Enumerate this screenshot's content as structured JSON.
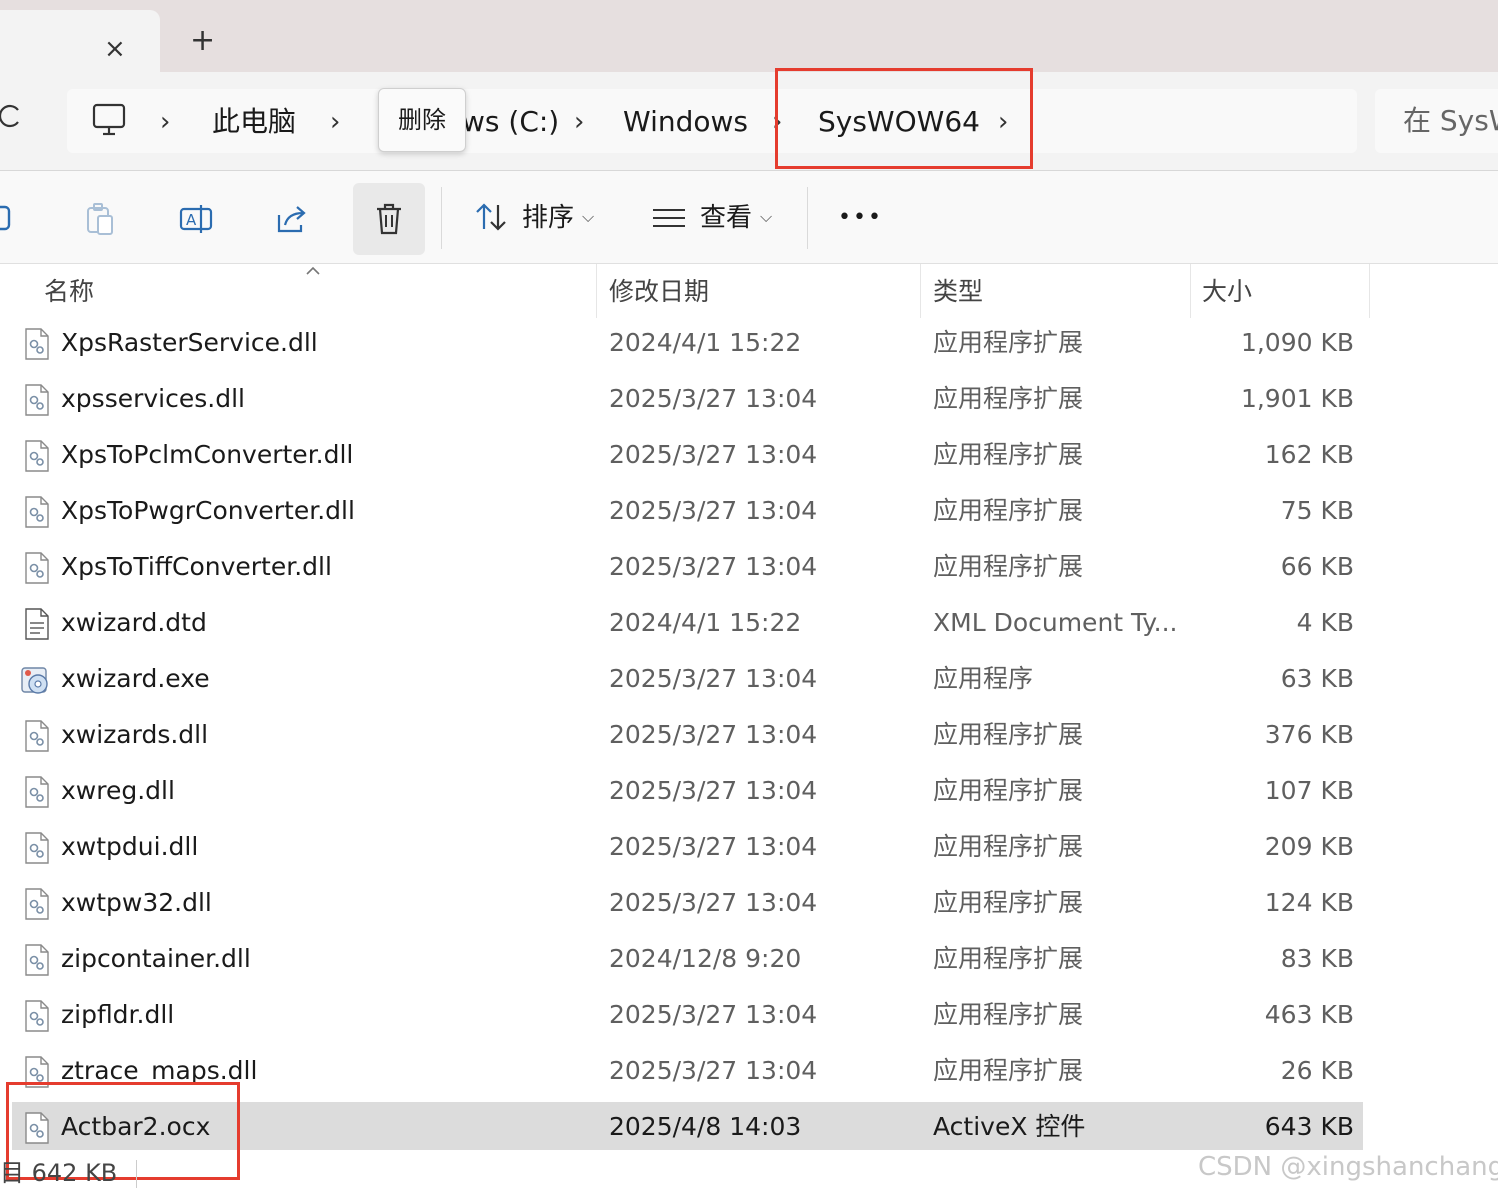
{
  "tab": {
    "close_icon": "×",
    "new_icon": "+"
  },
  "address": {
    "refresh_icon": "refresh-icon",
    "breadcrumb": [
      "此电脑",
      "ws (C:)",
      "Windows",
      "SysWOW64"
    ],
    "chevron": "›",
    "tooltip": "删除",
    "search_placeholder": "在 SysW"
  },
  "toolbar": {
    "sort_label": "排序",
    "view_label": "查看",
    "more_label": "•••",
    "caret": "⌵"
  },
  "columns": {
    "name": "名称",
    "date": "修改日期",
    "type": "类型",
    "size": "大小"
  },
  "files": [
    {
      "name": "XpsRasterService.dll",
      "date": "2024/4/1 15:22",
      "type": "应用程序扩展",
      "size": "1,090 KB",
      "icon": "dll-icon"
    },
    {
      "name": "xpsservices.dll",
      "date": "2025/3/27 13:04",
      "type": "应用程序扩展",
      "size": "1,901 KB",
      "icon": "dll-icon"
    },
    {
      "name": "XpsToPclmConverter.dll",
      "date": "2025/3/27 13:04",
      "type": "应用程序扩展",
      "size": "162 KB",
      "icon": "dll-icon"
    },
    {
      "name": "XpsToPwgrConverter.dll",
      "date": "2025/3/27 13:04",
      "type": "应用程序扩展",
      "size": "75 KB",
      "icon": "dll-icon"
    },
    {
      "name": "XpsToTiffConverter.dll",
      "date": "2025/3/27 13:04",
      "type": "应用程序扩展",
      "size": "66 KB",
      "icon": "dll-icon"
    },
    {
      "name": "xwizard.dtd",
      "date": "2024/4/1 15:22",
      "type": "XML Document Ty...",
      "size": "4 KB",
      "icon": "document-icon"
    },
    {
      "name": "xwizard.exe",
      "date": "2025/3/27 13:04",
      "type": "应用程序",
      "size": "63 KB",
      "icon": "exe-icon"
    },
    {
      "name": "xwizards.dll",
      "date": "2025/3/27 13:04",
      "type": "应用程序扩展",
      "size": "376 KB",
      "icon": "dll-icon"
    },
    {
      "name": "xwreg.dll",
      "date": "2025/3/27 13:04",
      "type": "应用程序扩展",
      "size": "107 KB",
      "icon": "dll-icon"
    },
    {
      "name": "xwtpdui.dll",
      "date": "2025/3/27 13:04",
      "type": "应用程序扩展",
      "size": "209 KB",
      "icon": "dll-icon"
    },
    {
      "name": "xwtpw32.dll",
      "date": "2025/3/27 13:04",
      "type": "应用程序扩展",
      "size": "124 KB",
      "icon": "dll-icon"
    },
    {
      "name": "zipcontainer.dll",
      "date": "2024/12/8 9:20",
      "type": "应用程序扩展",
      "size": "83 KB",
      "icon": "dll-icon"
    },
    {
      "name": "zipfldr.dll",
      "date": "2025/3/27 13:04",
      "type": "应用程序扩展",
      "size": "463 KB",
      "icon": "dll-icon"
    },
    {
      "name": "ztrace_maps.dll",
      "date": "2025/3/27 13:04",
      "type": "应用程序扩展",
      "size": "26 KB",
      "icon": "dll-icon"
    },
    {
      "name": "Actbar2.ocx",
      "date": "2025/4/8 14:03",
      "type": "ActiveX 控件",
      "size": "643 KB",
      "icon": "dll-icon",
      "selected": true
    }
  ],
  "status_text": "目  642 KB",
  "watermark": "CSDN @xingshanchang",
  "colors": {
    "highlight": "#e53c2e",
    "selected_row": "#dcdcdc"
  }
}
